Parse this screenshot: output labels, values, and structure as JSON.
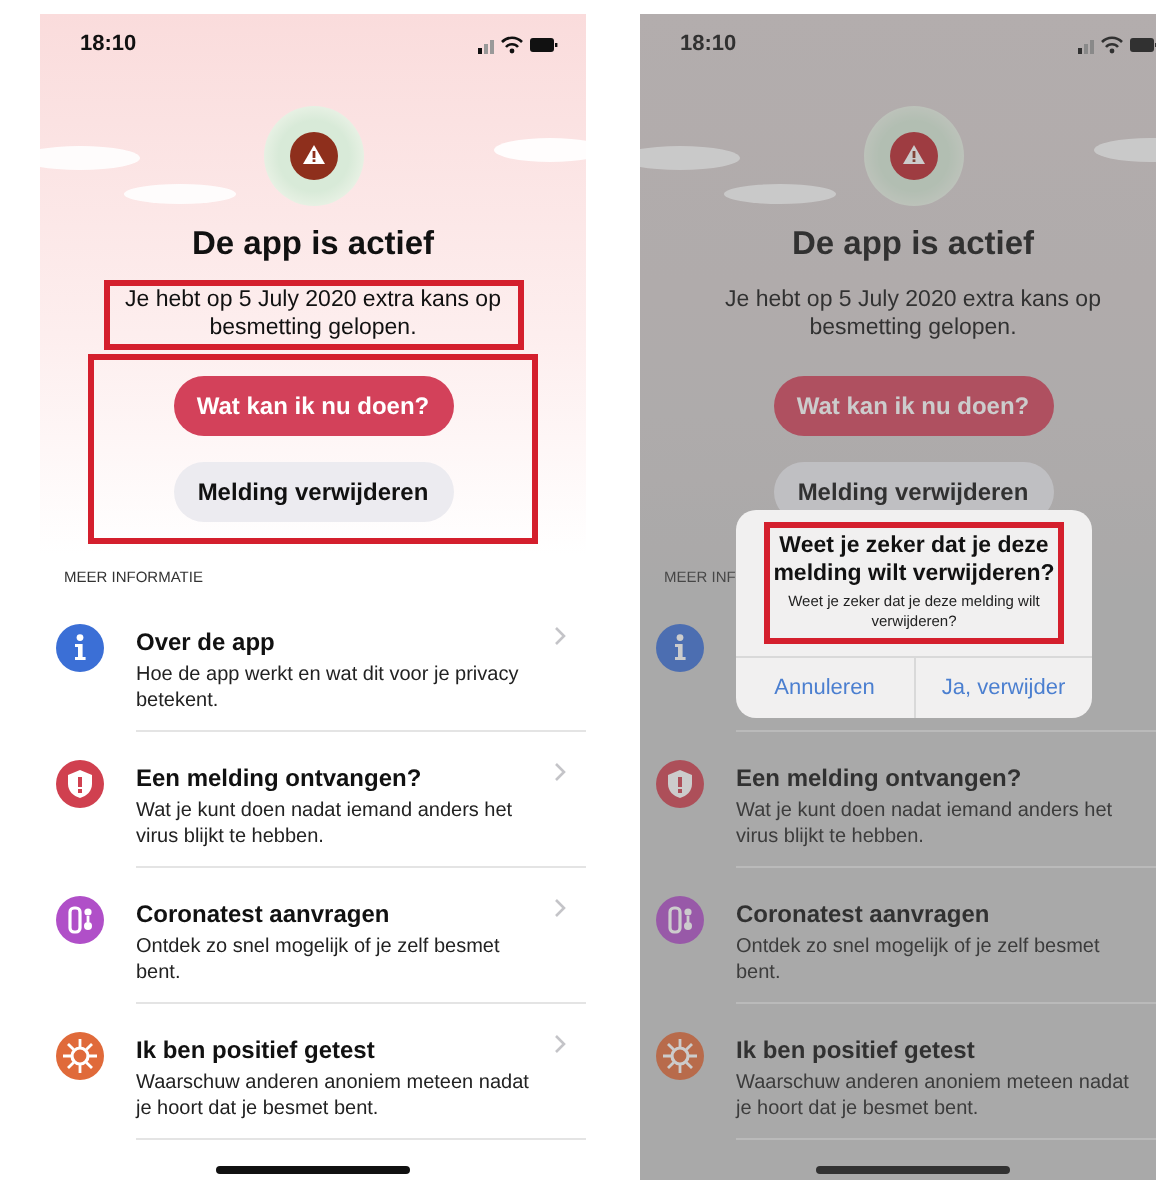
{
  "screens": [
    {
      "status_bar": {
        "time": "18:10"
      },
      "dimmed": false,
      "status": {
        "title": "De app is actief",
        "message": "Je hebt op 5 July 2020 extra kans op besmetting gelopen.",
        "highlighted": true
      },
      "buttons": [
        {
          "label": "Wat kan ik nu doen?",
          "kind": "primary"
        },
        {
          "label": "Melding verwijderen",
          "kind": "secondary"
        }
      ],
      "buttons_highlighted": true,
      "section_title": "MEER INFORMATIE",
      "items": [
        {
          "kind": "info",
          "title": "Over de app",
          "description": "Hoe de app werkt en wat dit voor je privacy betekent.",
          "chevron": true
        },
        {
          "kind": "alert",
          "title": "Een melding ontvangen?",
          "description": "Wat je kunt doen nadat iemand anders het virus blijkt te hebben.",
          "chevron": true
        },
        {
          "kind": "test",
          "title": "Coronatest aanvragen",
          "description": "Ontdek zo snel mogelijk of je zelf besmet bent.",
          "chevron": true
        },
        {
          "kind": "positive",
          "title": "Ik ben positief getest",
          "description": "Waarschuw anderen anoniem meteen nadat je hoort dat je besmet bent.",
          "chevron": true
        }
      ]
    },
    {
      "status_bar": {
        "time": "18:10"
      },
      "dimmed": true,
      "status": {
        "title": "De app is actief",
        "message": "Je hebt op 5 July 2020 extra kans op besmetting gelopen.",
        "highlighted": false
      },
      "buttons": [
        {
          "label": "Wat kan ik nu doen?",
          "kind": "primary"
        },
        {
          "label": "Melding verwijderen",
          "kind": "secondary"
        }
      ],
      "buttons_highlighted": false,
      "section_title": "MEER INF",
      "items": [
        {
          "kind": "info",
          "chevron": false
        },
        {
          "kind": "alert",
          "title": "Een melding ontvangen?",
          "description": "Wat je kunt doen nadat iemand anders het virus blijkt te hebben.",
          "chevron": false
        },
        {
          "kind": "test",
          "title": "Coronatest aanvragen",
          "description": "Ontdek zo snel mogelijk of je zelf besmet bent.",
          "chevron": false
        },
        {
          "kind": "positive",
          "title": "Ik ben positief getest",
          "description": "Waarschuw anderen anoniem meteen nadat je hoort dat je besmet bent.",
          "chevron": false
        }
      ],
      "dialog": {
        "title": "Weet je zeker dat je deze melding wilt verwijderen?",
        "message": "Weet je zeker dat je deze melding wilt verwijderen?",
        "highlighted": true,
        "actions": [
          {
            "label": "Annuleren"
          },
          {
            "label": "Ja, verwijder"
          }
        ]
      }
    }
  ]
}
